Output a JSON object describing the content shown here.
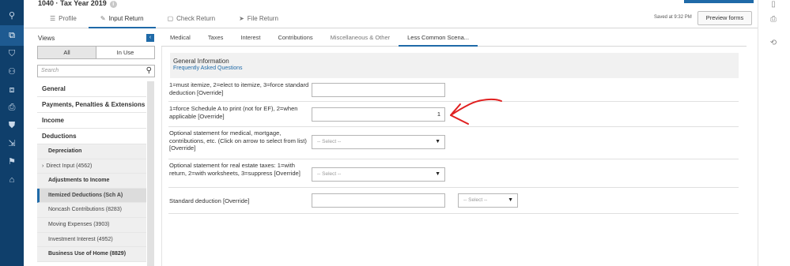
{
  "header": {
    "title": "1040 · Tax Year 2019",
    "info_glyph": "i",
    "tabs": [
      {
        "label": "Profile",
        "icon": "list-icon",
        "glyph": "☰"
      },
      {
        "label": "Input Return",
        "icon": "pencil-icon",
        "glyph": "✎"
      },
      {
        "label": "Check Return",
        "icon": "document-icon",
        "glyph": "▢"
      },
      {
        "label": "File Return",
        "icon": "send-icon",
        "glyph": "➤"
      }
    ],
    "saved": "Saved at 9:32 PM",
    "preview_label": "Preview forms"
  },
  "views": {
    "title": "Views",
    "collapse_glyph": "‹",
    "filter_all": "All",
    "filter_in_use": "In Use",
    "search_placeholder": "Search",
    "search_glyph": "⚲",
    "caret_glyph": "›",
    "items": [
      {
        "label": "General",
        "kind": "hdr"
      },
      {
        "label": "Payments, Penalties & Extensions",
        "kind": "hdr"
      },
      {
        "label": "Income",
        "kind": "hdr"
      },
      {
        "label": "Deductions",
        "kind": "hdr"
      },
      {
        "label": "Depreciation",
        "kind": "sub-bold"
      },
      {
        "label": "Direct Input (4562)",
        "kind": "sub-caret"
      },
      {
        "label": "Adjustments to Income",
        "kind": "sub-bold"
      },
      {
        "label": "Itemized Deductions (Sch A)",
        "kind": "sub-selected"
      },
      {
        "label": "Noncash Contributions (8283)",
        "kind": "sub"
      },
      {
        "label": "Moving Expenses (3903)",
        "kind": "sub"
      },
      {
        "label": "Investment Interest (4952)",
        "kind": "sub"
      },
      {
        "label": "Business Use of Home (8829)",
        "kind": "sub-bold"
      }
    ]
  },
  "main_tabs": [
    {
      "label": "Medical"
    },
    {
      "label": "Taxes"
    },
    {
      "label": "Interest"
    },
    {
      "label": "Contributions"
    },
    {
      "label": "Miscellaneous & Other"
    },
    {
      "label": "Less Common Scena..."
    }
  ],
  "section": {
    "heading": "General Information",
    "faq_link": "Frequently Asked Questions"
  },
  "fields": {
    "itemize_label": "1=must itemize, 2=elect to itemize, 3=force standard deduction [Override]",
    "itemize_value": "",
    "schA_label": "1=force Schedule A to print (not for EF), 2=when applicable [Override]",
    "schA_value": "1",
    "medical_stmt_label": "Optional statement for medical, mortgage, contributions, etc. (Click on arrow to select from list) [Override]",
    "medical_stmt_value": "-- Select --",
    "re_tax_label": "Optional statement for real estate taxes: 1=with return, 2=with worksheets, 3=suppress [Override]",
    "re_tax_value": "-- Select --",
    "std_ded_label": "Standard deduction [Override]",
    "std_ded_value": "",
    "std_ded_select": "-- Select --",
    "dropdown_glyph": "▼"
  },
  "rail_icons": [
    {
      "name": "search-icon",
      "glyph": "⚲"
    },
    {
      "name": "returns-icon",
      "glyph": "⧉"
    },
    {
      "name": "clients-icon",
      "glyph": "⛉"
    },
    {
      "name": "people-icon",
      "glyph": "⚇"
    },
    {
      "name": "layers-icon",
      "glyph": "⧈"
    },
    {
      "name": "clipboard-icon",
      "glyph": "⎙"
    },
    {
      "name": "tag-icon",
      "glyph": "⛊"
    },
    {
      "name": "login-icon",
      "glyph": "⇲"
    },
    {
      "name": "flag-icon",
      "glyph": "⚑"
    },
    {
      "name": "building-icon",
      "glyph": "⌂"
    }
  ],
  "right_rail_icons": [
    {
      "name": "phone-icon",
      "glyph": "▯"
    },
    {
      "name": "clipboard-icon",
      "glyph": "⎙"
    },
    {
      "name": "history-icon",
      "glyph": "⟲"
    }
  ],
  "colors": {
    "accent": "#1f6aa8",
    "rail": "#0f3f6b",
    "annotation": "#e02020"
  }
}
